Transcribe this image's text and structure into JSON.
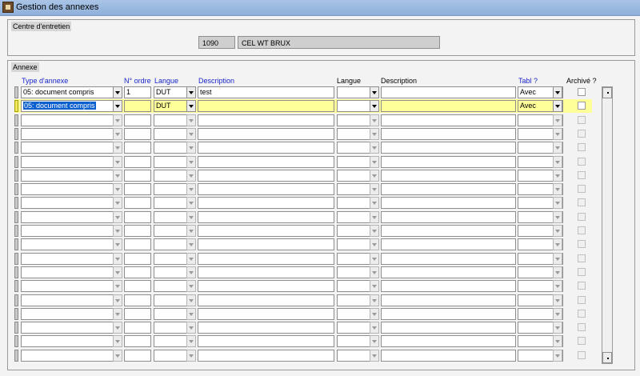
{
  "window": {
    "title": "Gestion des annexes"
  },
  "centre": {
    "label": "Centre d'entretien",
    "code": "1090",
    "name": "CEL WT BRUX"
  },
  "annexe": {
    "label": "Annexe",
    "headers": {
      "type": "Type d'annexe",
      "ordre": "N° ordre",
      "langue1": "Langue",
      "desc1": "Description",
      "langue2": "Langue",
      "desc2": "Description",
      "tabl": "Tabl ?",
      "archive": "Archivé ?"
    },
    "rows": [
      {
        "type": "05: document compris",
        "ordre": "1",
        "langue1": "DUT",
        "desc1": "test",
        "langue2": "",
        "desc2": "",
        "tabl": "Avec"
      },
      {
        "type": "05: document compris",
        "ordre": "",
        "langue1": "DUT",
        "desc1": "",
        "langue2": "",
        "desc2": "",
        "tabl": "Avec"
      },
      {
        "type": "",
        "ordre": "",
        "langue1": "",
        "desc1": "",
        "langue2": "",
        "desc2": "",
        "tabl": ""
      },
      {
        "type": "",
        "ordre": "",
        "langue1": "",
        "desc1": "",
        "langue2": "",
        "desc2": "",
        "tabl": ""
      },
      {
        "type": "",
        "ordre": "",
        "langue1": "",
        "desc1": "",
        "langue2": "",
        "desc2": "",
        "tabl": ""
      },
      {
        "type": "",
        "ordre": "",
        "langue1": "",
        "desc1": "",
        "langue2": "",
        "desc2": "",
        "tabl": ""
      },
      {
        "type": "",
        "ordre": "",
        "langue1": "",
        "desc1": "",
        "langue2": "",
        "desc2": "",
        "tabl": ""
      },
      {
        "type": "",
        "ordre": "",
        "langue1": "",
        "desc1": "",
        "langue2": "",
        "desc2": "",
        "tabl": ""
      },
      {
        "type": "",
        "ordre": "",
        "langue1": "",
        "desc1": "",
        "langue2": "",
        "desc2": "",
        "tabl": ""
      },
      {
        "type": "",
        "ordre": "",
        "langue1": "",
        "desc1": "",
        "langue2": "",
        "desc2": "",
        "tabl": ""
      },
      {
        "type": "",
        "ordre": "",
        "langue1": "",
        "desc1": "",
        "langue2": "",
        "desc2": "",
        "tabl": ""
      },
      {
        "type": "",
        "ordre": "",
        "langue1": "",
        "desc1": "",
        "langue2": "",
        "desc2": "",
        "tabl": ""
      },
      {
        "type": "",
        "ordre": "",
        "langue1": "",
        "desc1": "",
        "langue2": "",
        "desc2": "",
        "tabl": ""
      },
      {
        "type": "",
        "ordre": "",
        "langue1": "",
        "desc1": "",
        "langue2": "",
        "desc2": "",
        "tabl": ""
      },
      {
        "type": "",
        "ordre": "",
        "langue1": "",
        "desc1": "",
        "langue2": "",
        "desc2": "",
        "tabl": ""
      },
      {
        "type": "",
        "ordre": "",
        "langue1": "",
        "desc1": "",
        "langue2": "",
        "desc2": "",
        "tabl": ""
      },
      {
        "type": "",
        "ordre": "",
        "langue1": "",
        "desc1": "",
        "langue2": "",
        "desc2": "",
        "tabl": ""
      },
      {
        "type": "",
        "ordre": "",
        "langue1": "",
        "desc1": "",
        "langue2": "",
        "desc2": "",
        "tabl": ""
      },
      {
        "type": "",
        "ordre": "",
        "langue1": "",
        "desc1": "",
        "langue2": "",
        "desc2": "",
        "tabl": ""
      },
      {
        "type": "",
        "ordre": "",
        "langue1": "",
        "desc1": "",
        "langue2": "",
        "desc2": "",
        "tabl": ""
      }
    ]
  },
  "colors": {
    "title_bar": "#9dbbe0",
    "current_row": "#ffff99",
    "selection": "#0b5fce",
    "header_text": "#1a25c9"
  }
}
